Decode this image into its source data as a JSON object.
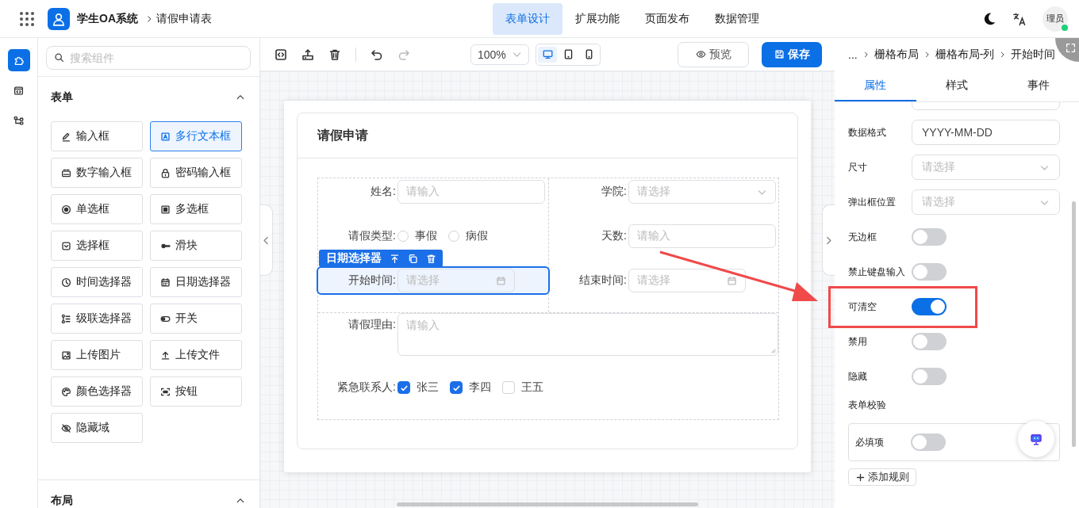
{
  "topbar": {
    "app_title": "学生OA系统",
    "breadcrumb": "请假申请表",
    "avatar": "理员",
    "nav": [
      {
        "label": "表单设计",
        "selected": true
      },
      {
        "label": "扩展功能",
        "selected": false
      },
      {
        "label": "页面发布",
        "selected": false
      },
      {
        "label": "数据管理",
        "selected": false
      }
    ]
  },
  "rail": [
    {
      "selected": true
    },
    {
      "selected": false
    },
    {
      "selected": false
    }
  ],
  "palette": {
    "search_placeholder": "搜索组件",
    "sections": [
      {
        "title": "表单",
        "expanded": true,
        "items": [
          {
            "label": "输入框",
            "selected": false
          },
          {
            "label": "多行文本框",
            "selected": true
          },
          {
            "label": "数字输入框",
            "selected": false
          },
          {
            "label": "密码输入框",
            "selected": false
          },
          {
            "label": "单选框",
            "selected": false
          },
          {
            "label": "多选框",
            "selected": false
          },
          {
            "label": "选择框",
            "selected": false
          },
          {
            "label": "滑块",
            "selected": false
          },
          {
            "label": "时间选择器",
            "selected": false
          },
          {
            "label": "日期选择器",
            "selected": false
          },
          {
            "label": "级联选择器",
            "selected": false
          },
          {
            "label": "开关",
            "selected": false
          },
          {
            "label": "上传图片",
            "selected": false
          },
          {
            "label": "上传文件",
            "selected": false
          },
          {
            "label": "颜色选择器",
            "selected": false
          },
          {
            "label": "按钮",
            "selected": false
          },
          {
            "label": "隐藏域",
            "selected": false
          }
        ]
      },
      {
        "title": "布局",
        "expanded": true
      }
    ]
  },
  "toolbar": {
    "zoom": "100%",
    "devices": [
      {
        "selected": true
      },
      {
        "selected": false
      },
      {
        "selected": false
      }
    ],
    "preview": "预览",
    "save": "保存"
  },
  "form": {
    "title": "请假申请",
    "columns": [
      [
        {
          "kind": "input",
          "label": "姓名:",
          "placeholder": "请输入",
          "selected": false
        },
        {
          "kind": "radio",
          "label": "请假类型:",
          "options": [
            {
              "label": "事假",
              "checked": false
            },
            {
              "label": "病假",
              "checked": false
            }
          ],
          "selected": false
        },
        {
          "kind": "date",
          "label": "开始时间:",
          "placeholder": "请选择",
          "selected": true,
          "tag": "日期选择器"
        }
      ],
      [
        {
          "kind": "select",
          "label": "学院:",
          "placeholder": "请选择",
          "selected": false
        },
        {
          "kind": "input",
          "label": "天数:",
          "placeholder": "请输入",
          "selected": false
        },
        {
          "kind": "date",
          "label": "结束时间:",
          "placeholder": "请选择",
          "selected": false
        }
      ]
    ],
    "rows": [
      {
        "kind": "textarea",
        "label": "请假理由:",
        "placeholder": "请输入",
        "selected": false
      },
      {
        "kind": "checkbox",
        "label": "紧急联系人:",
        "options": [
          {
            "label": "张三",
            "checked": true
          },
          {
            "label": "李四",
            "checked": true
          },
          {
            "label": "王五",
            "checked": false
          }
        ],
        "selected": false
      }
    ]
  },
  "props": {
    "breadcrumb": [
      "...",
      "栅格布局",
      "栅格布局-列",
      "开始时间"
    ],
    "tabs": [
      {
        "label": "属性",
        "selected": true
      },
      {
        "label": "样式",
        "selected": false
      },
      {
        "label": "事件",
        "selected": false
      }
    ],
    "rows": [
      {
        "kind": "input",
        "label": "数据格式",
        "value": "YYYY-MM-DD"
      },
      {
        "kind": "select",
        "label": "尺寸",
        "placeholder": "请选择"
      },
      {
        "kind": "select",
        "label": "弹出框位置",
        "placeholder": "请选择"
      },
      {
        "kind": "switch",
        "label": "无边框",
        "on": false
      },
      {
        "kind": "switch",
        "label": "禁止键盘输入",
        "on": false
      },
      {
        "kind": "switch",
        "label": "可清空",
        "on": true
      },
      {
        "kind": "switch",
        "label": "禁用",
        "on": false
      },
      {
        "kind": "switch",
        "label": "隐藏",
        "on": false
      }
    ],
    "validation_title": "表单校验",
    "rules": [
      {
        "label": "必填项",
        "on": false
      }
    ],
    "add_rule": "添加规则"
  }
}
